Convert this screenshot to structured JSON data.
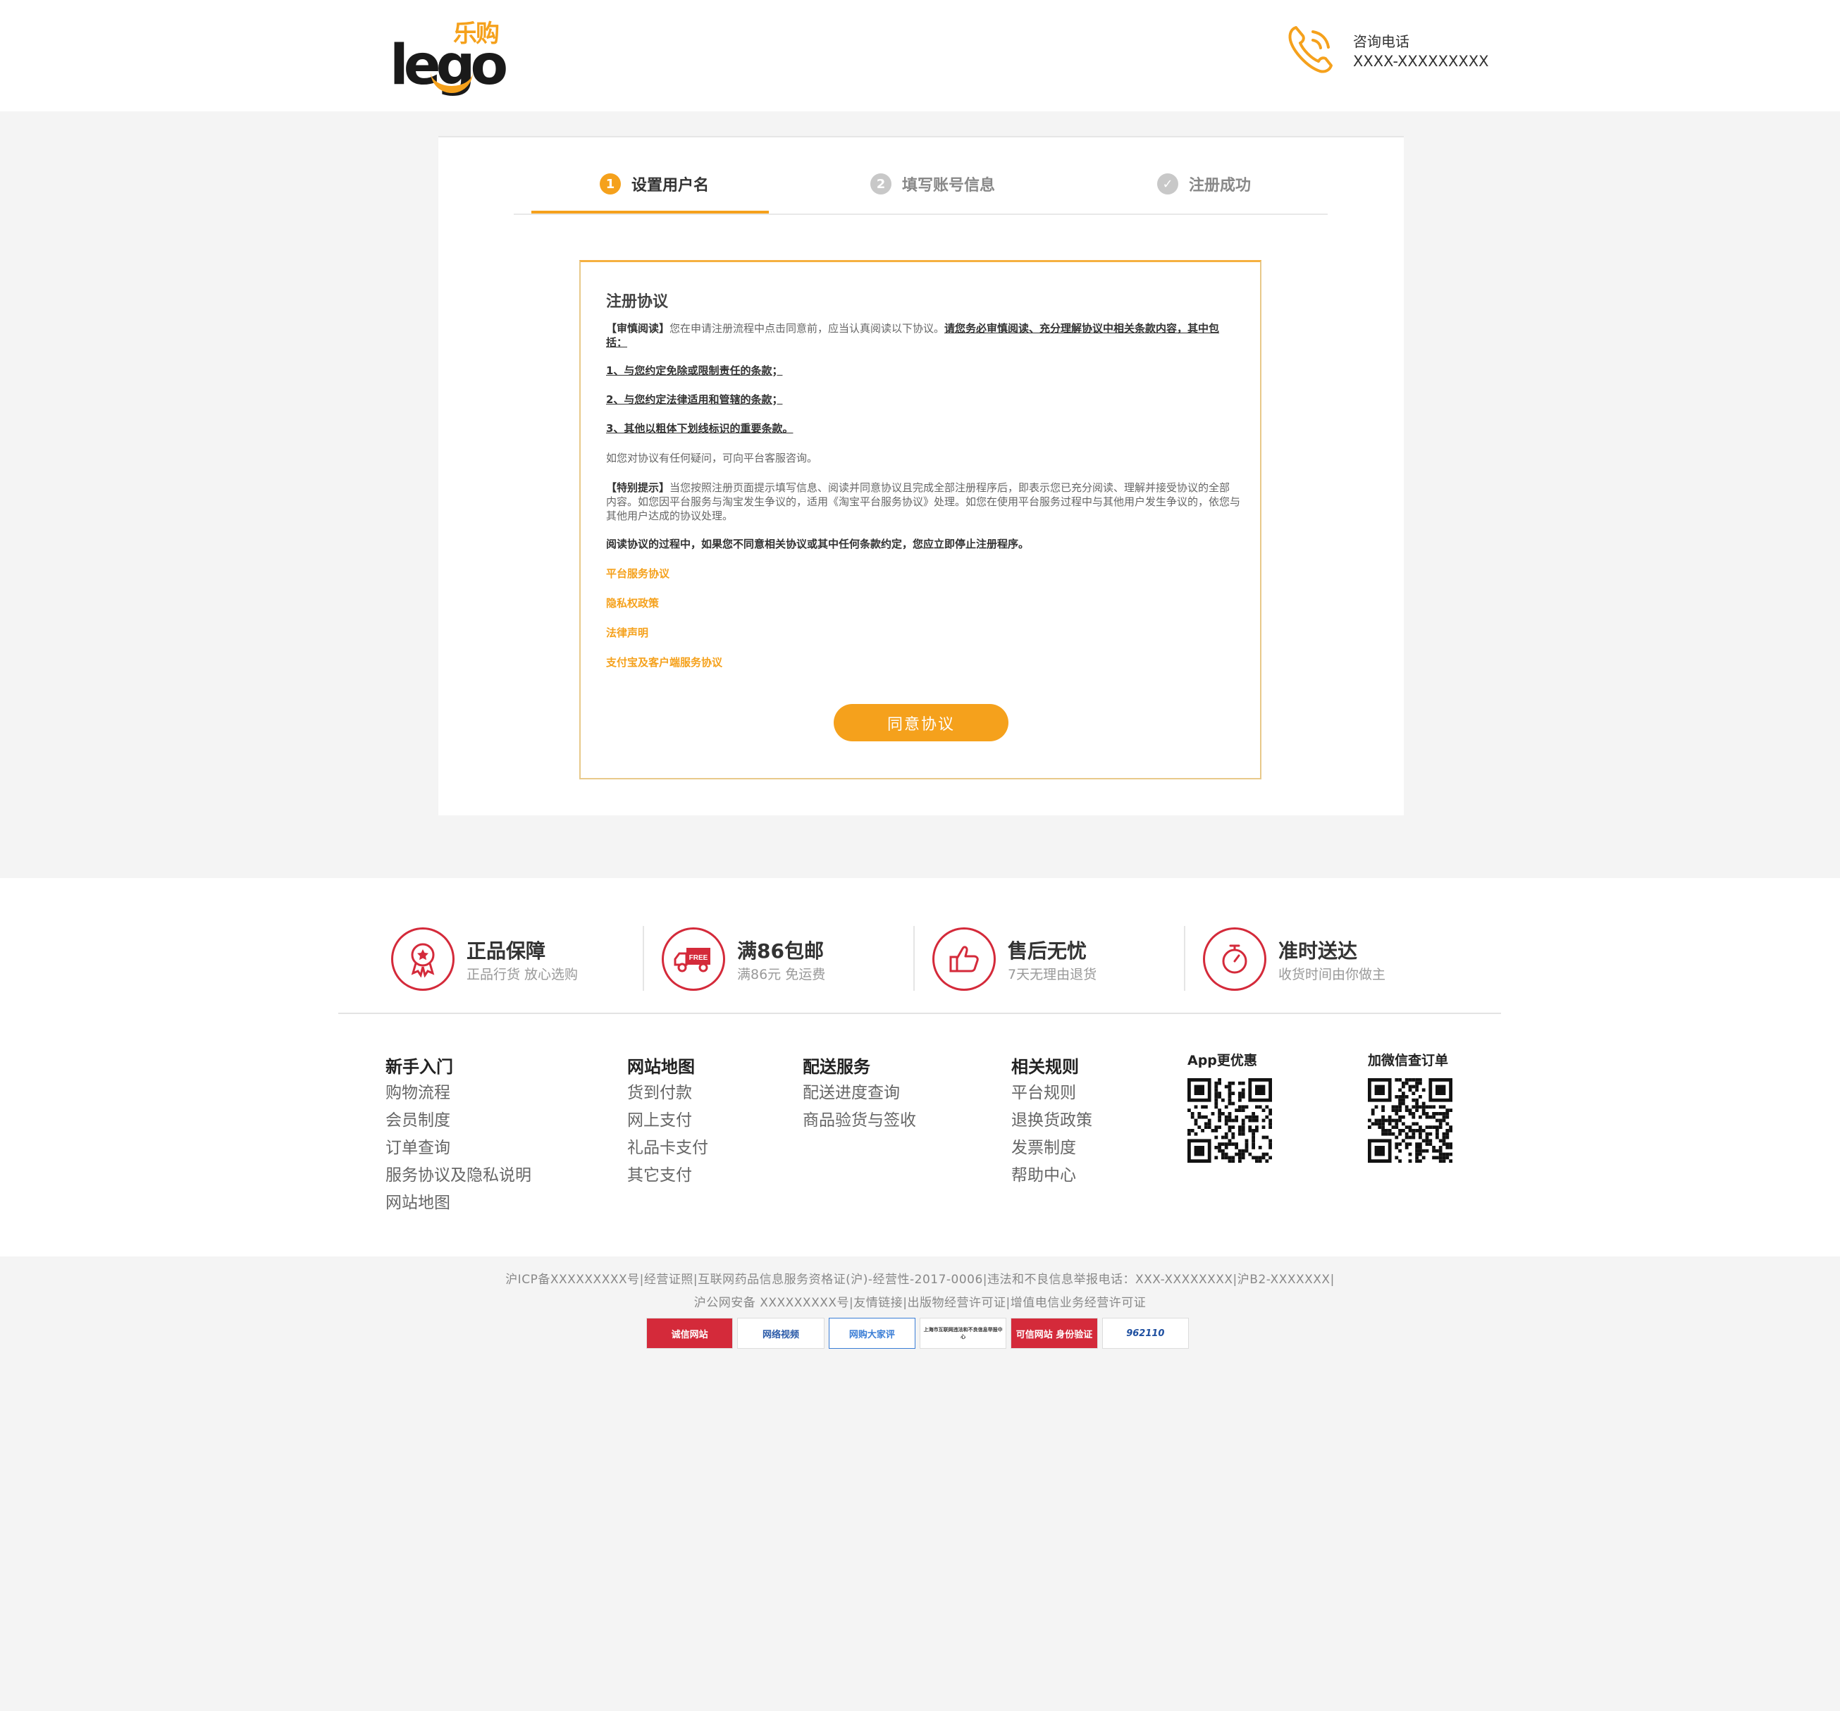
{
  "header": {
    "logo_cn": "乐购",
    "logo_en": "lego",
    "hotline_title": "咨询电话",
    "hotline_number": "XXXX-XXXXXXXXX"
  },
  "steps": [
    {
      "num": "1",
      "label": "设置用户名",
      "active": true
    },
    {
      "num": "2",
      "label": "填写账号信息",
      "active": false
    },
    {
      "num": "✓",
      "label": "注册成功",
      "active": false
    }
  ],
  "agreement": {
    "title": "注册协议",
    "p1_lead": "【审慎阅读】",
    "p1_text": "您在申请注册流程中点击同意前，应当认真阅读以下协议。",
    "p1_underline": "请您务必审慎阅读、充分理解协议中相关条款内容，其中包括：",
    "item1": "1、与您约定免除或限制责任的条款；",
    "item2": "2、与您约定法律适用和管辖的条款；",
    "item3": "3、其他以粗体下划线标识的重要条款。",
    "p2": "如您对协议有任何疑问，可向平台客服咨询。",
    "p3_lead": "【特别提示】",
    "p3_text": "当您按照注册页面提示填写信息、阅读并同意协议且完成全部注册程序后，即表示您已充分阅读、理解并接受协议的全部内容。如您因平台服务与淘宝发生争议的，适用《淘宝平台服务协议》处理。如您在使用平台服务过程中与其他用户发生争议的，依您与其他用户达成的协议处理。",
    "p4": "阅读协议的过程中，如果您不同意相关协议或其中任何条款约定，您应立即停止注册程序。",
    "link1": "平台服务协议",
    "link2": "隐私权政策",
    "link3": "法律声明",
    "link4": "支付宝及客户端服务协议",
    "agree_button": "同意协议"
  },
  "guarantees": [
    {
      "title": "正品保障",
      "sub": "正品行货 放心选购",
      "icon": "medal-icon"
    },
    {
      "title": "满86包邮",
      "sub": "满86元 免运费",
      "icon": "truck-icon"
    },
    {
      "title": "售后无忧",
      "sub": "7天无理由退货",
      "icon": "thumbs-up-icon"
    },
    {
      "title": "准时送达",
      "sub": "收货时间由你做主",
      "icon": "stopwatch-icon"
    }
  ],
  "link_columns": [
    {
      "title": "新手入门",
      "items": [
        "购物流程",
        "会员制度",
        "订单查询",
        "服务协议及隐私说明",
        "网站地图"
      ]
    },
    {
      "title": "网站地图",
      "items": [
        "货到付款",
        "网上支付",
        "礼品卡支付",
        "其它支付"
      ]
    },
    {
      "title": "配送服务",
      "items": [
        "配送进度查询",
        "商品验货与签收"
      ]
    },
    {
      "title": "相关规则",
      "items": [
        "平台规则",
        "退换货政策",
        "发票制度",
        "帮助中心"
      ]
    }
  ],
  "qr_codes": [
    {
      "title": "App更优惠"
    },
    {
      "title": "加微信查订单"
    }
  ],
  "bottom": {
    "line1": "沪ICP备XXXXXXXXX号|经营证照|互联网药品信息服务资格证(沪)-经营性-2017-0006|违法和不良信息举报电话：XXX-XXXXXXXX|沪B2-XXXXXXX|",
    "line2": "沪公网安备 XXXXXXXXX号|友情链接|出版物经营许可证|增值电信业务经营许可证",
    "badges": [
      "诚信网站",
      "网络视频",
      "网购大家评",
      "上海市互联网违法和不良信息举报中心",
      "可信网站 身份验证",
      "962110"
    ]
  },
  "colors": {
    "accent": "#f5a11c",
    "guarantee_red": "#d42a3a"
  }
}
